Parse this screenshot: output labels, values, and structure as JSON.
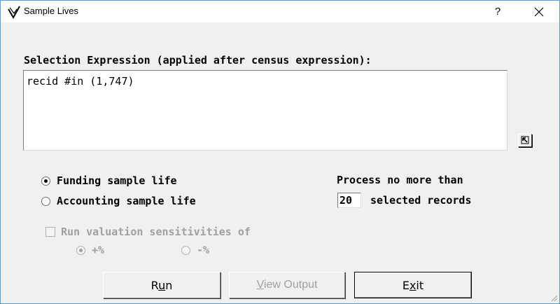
{
  "window": {
    "title": "Sample Lives",
    "help_glyph": "?",
    "app_icon": "check-diamond-icon",
    "close_icon": "close-icon"
  },
  "selection": {
    "label": "Selection Expression (applied after census expression):",
    "expression": "recid #in (1,747)",
    "expand_icon": "expand-arrow-icon"
  },
  "sample_type": {
    "options": [
      {
        "label": "Funding sample life",
        "checked": true
      },
      {
        "label": "Accounting sample life",
        "checked": false
      }
    ]
  },
  "process": {
    "label": "Process no more than",
    "count": "20",
    "suffix": "selected records"
  },
  "sensitivity": {
    "checkbox_label": "Run valuation sensitivities of",
    "checked": false,
    "options": [
      {
        "label": "+%",
        "checked": true
      },
      {
        "label": "-%",
        "checked": false
      }
    ]
  },
  "buttons": {
    "run": {
      "pre": "R",
      "mnemonic": "u",
      "post": "n"
    },
    "view_output": {
      "pre": "",
      "mnemonic": "V",
      "post": "iew Output",
      "enabled": false
    },
    "exit": {
      "pre": "E",
      "mnemonic": "x",
      "post": "it"
    }
  },
  "colors": {
    "window_border": "#5b9bd5",
    "disabled_text": "#a0a0a0"
  }
}
